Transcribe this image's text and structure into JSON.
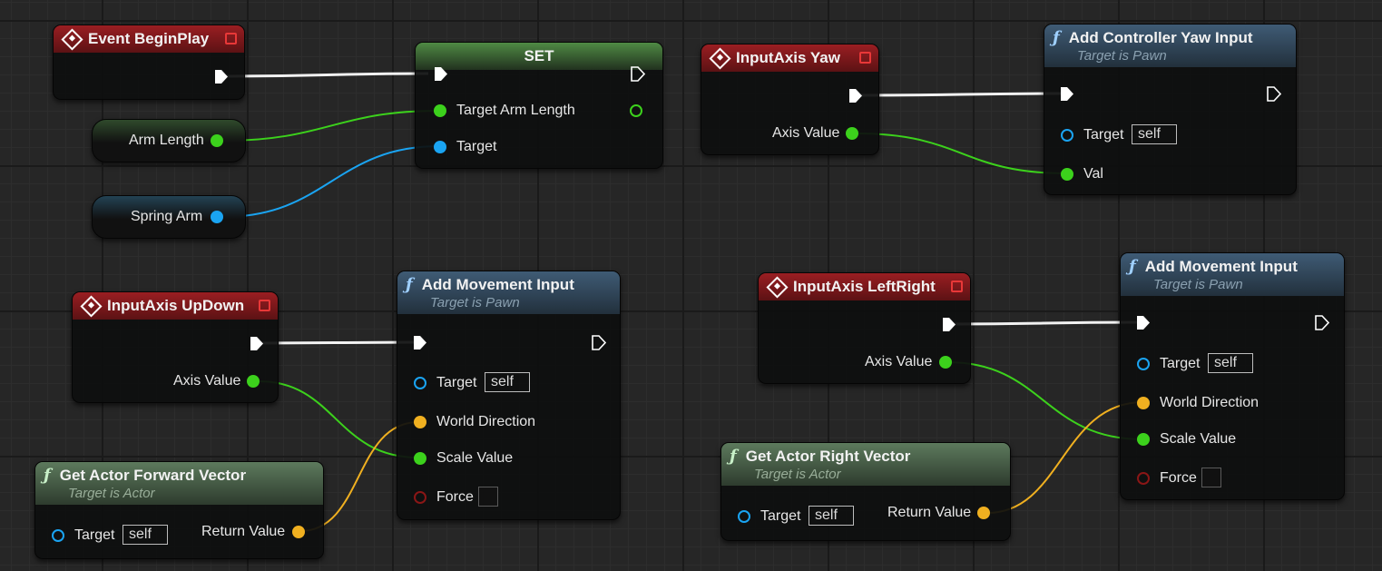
{
  "graph": {
    "event_begin_play": {
      "title": "Event BeginPlay"
    },
    "set_node": {
      "title": "SET",
      "pins": [
        "Target Arm Length",
        "Target"
      ]
    },
    "var_arm_length": {
      "label": "Arm Length"
    },
    "var_spring_arm": {
      "label": "Spring Arm"
    },
    "input_axis_yaw": {
      "title": "InputAxis Yaw",
      "axis_value": "Axis Value"
    },
    "add_controller_yaw": {
      "title": "Add Controller Yaw Input",
      "subtitle": "Target is Pawn",
      "target": "Target",
      "target_value": "self",
      "val": "Val"
    },
    "input_axis_updown": {
      "title": "InputAxis UpDown",
      "axis_value": "Axis Value"
    },
    "add_movement_1": {
      "title": "Add Movement Input",
      "subtitle": "Target is Pawn",
      "target": "Target",
      "target_value": "self",
      "world_direction": "World Direction",
      "scale_value": "Scale Value",
      "force": "Force"
    },
    "get_forward_vector": {
      "title": "Get Actor Forward Vector",
      "subtitle": "Target is Actor",
      "target": "Target",
      "target_value": "self",
      "return_value": "Return Value"
    },
    "input_axis_leftright": {
      "title": "InputAxis LeftRight",
      "axis_value": "Axis Value"
    },
    "add_movement_2": {
      "title": "Add Movement Input",
      "subtitle": "Target is Pawn",
      "target": "Target",
      "target_value": "self",
      "world_direction": "World Direction",
      "scale_value": "Scale Value",
      "force": "Force"
    },
    "get_right_vector": {
      "title": "Get Actor Right Vector",
      "subtitle": "Target is Actor",
      "target": "Target",
      "target_value": "self",
      "return_value": "Return Value"
    }
  },
  "colors": {
    "exec_wire": "#ffffff",
    "float_pin": "#3cd11c",
    "object_pin": "#1aa4f2",
    "vector_pin": "#f0b020",
    "bool_pin": "#8a1616",
    "event_header": "#9a1e22",
    "function_header": "#3f5b75",
    "pure_header": "#5d7a5d",
    "set_header": "#4f8a44"
  },
  "icons": {
    "event": "event-diamond-icon",
    "function": "function-f-icon",
    "exec": "exec-arrow-icon"
  }
}
